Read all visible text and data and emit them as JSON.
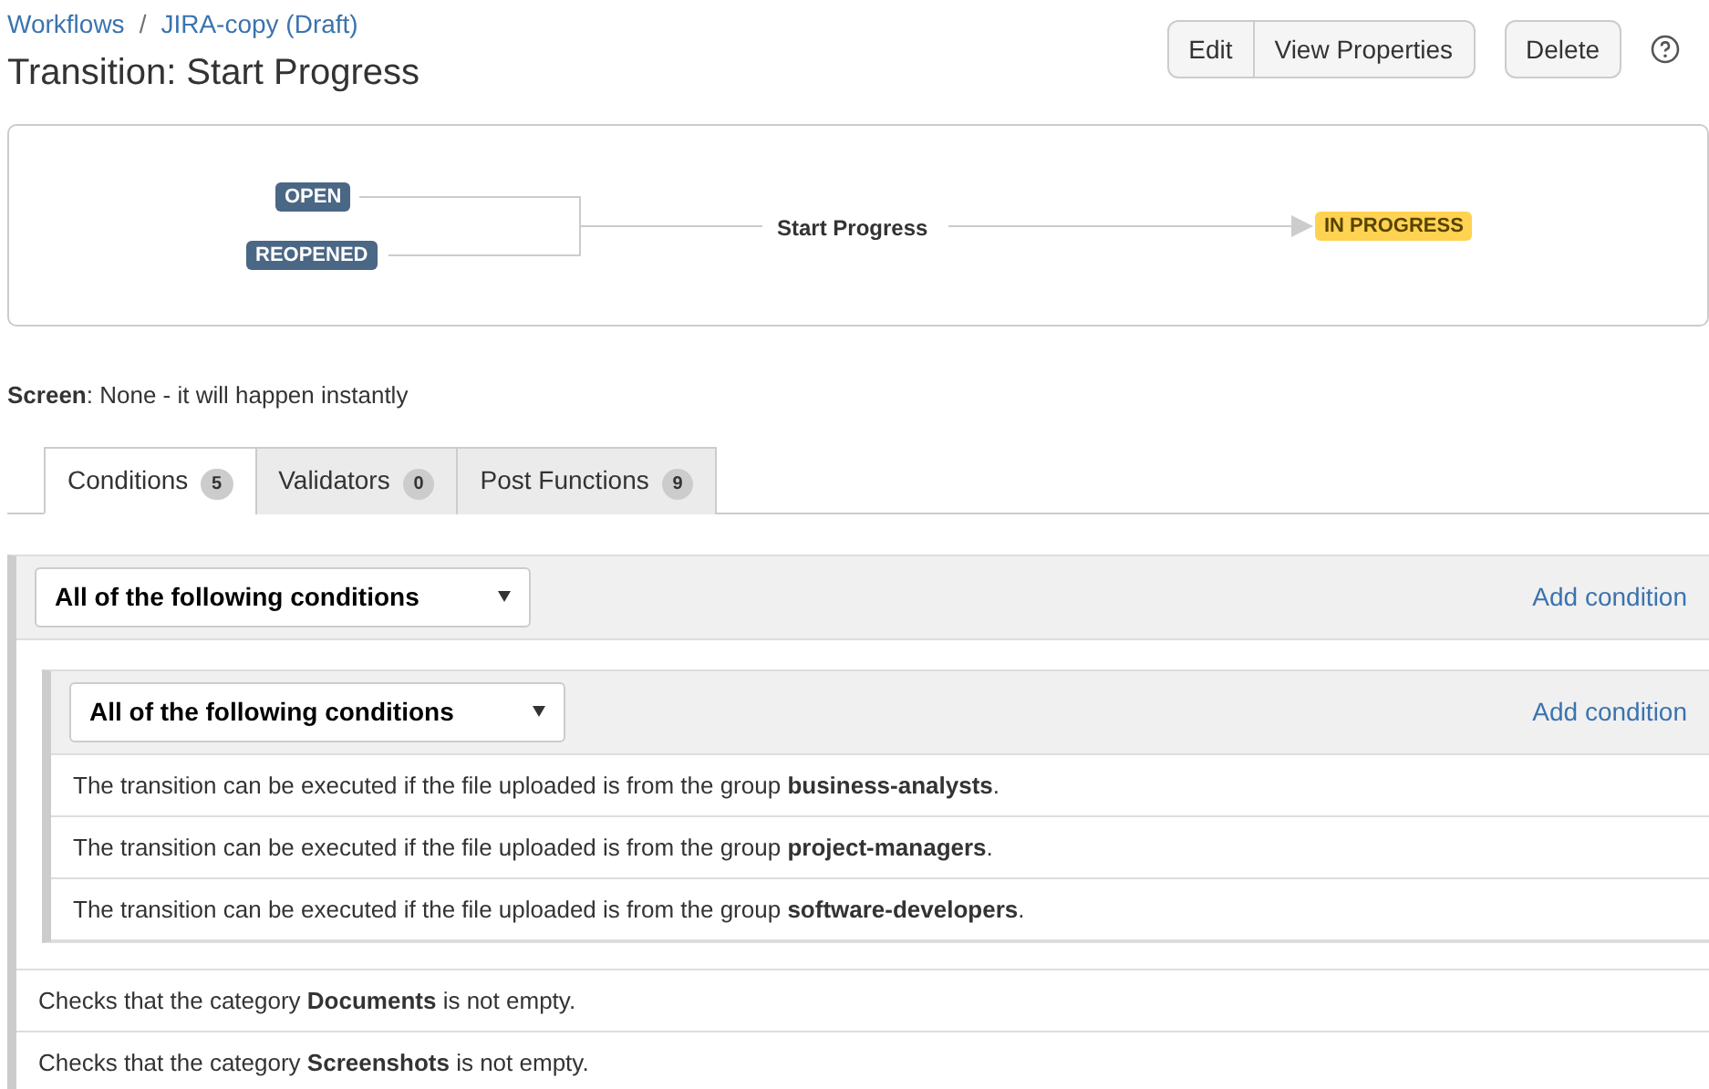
{
  "breadcrumbs": [
    "Workflows",
    "JIRA-copy (Draft)"
  ],
  "title": "Transition: Start Progress",
  "breadcrumb_separator": "/",
  "action_groups": [
    [
      "Edit",
      "View Properties"
    ],
    [
      "Delete"
    ]
  ],
  "diagram": {
    "sources": [
      {
        "label": "OPEN",
        "color": "#4a6785"
      },
      {
        "label": "REOPENED",
        "color": "#4a6785"
      }
    ],
    "transition": "Start Progress",
    "target": {
      "label": "IN PROGRESS",
      "color": "#ffd351"
    }
  },
  "screen_info": "**Screen**: None - it will happen instantly",
  "tabs": [
    {
      "label": "Conditions",
      "count": "5",
      "selected": true
    },
    {
      "label": "Validators",
      "count": "0",
      "selected": false
    },
    {
      "label": "Post Functions",
      "count": "9",
      "selected": false
    }
  ],
  "conditions": {
    "operator": "All of the following conditions",
    "add_link": "Add condition",
    "items": [
      {
        "kind": "group",
        "operator": "All of the following conditions",
        "add_link": "Add condition",
        "items": [
          {
            "kind": "text",
            "text": "The transition can be executed if the file uploaded is from the group **business-analysts**."
          },
          {
            "kind": "text",
            "text": "The transition can be executed if the file uploaded is from the group **project-managers**."
          },
          {
            "kind": "text",
            "text": "The transition can be executed if the file uploaded is from the group **software-developers**."
          }
        ]
      },
      {
        "kind": "text",
        "text": "Checks that the category **Documents** is not empty."
      },
      {
        "kind": "text",
        "text": "Checks that the category **Screenshots** is not empty."
      }
    ]
  }
}
